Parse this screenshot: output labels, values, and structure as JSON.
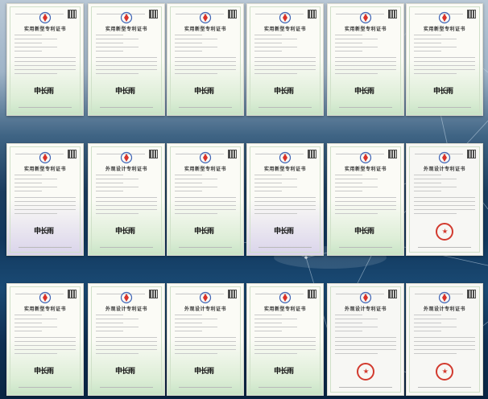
{
  "background": {
    "top_color": "#b9c8d6",
    "mid_color": "#11375c",
    "bottom_color": "#0a2544",
    "accent_net_color": "#d8e8f5"
  },
  "certificate_types": {
    "utility_model": "实用新型专利证书",
    "design": "外观设计专利证书"
  },
  "signature_text": "申长雨",
  "rows": [
    {
      "certificates": [
        {
          "title": "实用新型专利证书",
          "style": "green"
        },
        {
          "title": "实用新型专利证书",
          "style": "green"
        },
        {
          "title": "实用新型专利证书",
          "style": "green"
        },
        {
          "title": "实用新型专利证书",
          "style": "green"
        },
        {
          "title": "实用新型专利证书",
          "style": "green"
        },
        {
          "title": "实用新型专利证书",
          "style": "green"
        }
      ]
    },
    {
      "certificates": [
        {
          "title": "实用新型专利证书",
          "style": "purple"
        },
        {
          "title": "外观设计专利证书",
          "style": "green"
        },
        {
          "title": "实用新型专利证书",
          "style": "green"
        },
        {
          "title": "实用新型专利证书",
          "style": "purple"
        },
        {
          "title": "实用新型专利证书",
          "style": "green"
        },
        {
          "title": "外观设计专利证书",
          "style": "plain"
        }
      ]
    },
    {
      "certificates": [
        {
          "title": "实用新型专利证书",
          "style": "green"
        },
        {
          "title": "外观设计专利证书",
          "style": "green"
        },
        {
          "title": "外观设计专利证书",
          "style": "green"
        },
        {
          "title": "实用新型专利证书",
          "style": "green"
        },
        {
          "title": "外观设计专利证书",
          "style": "plain"
        },
        {
          "title": "外观设计专利证书",
          "style": "plain"
        }
      ]
    }
  ]
}
